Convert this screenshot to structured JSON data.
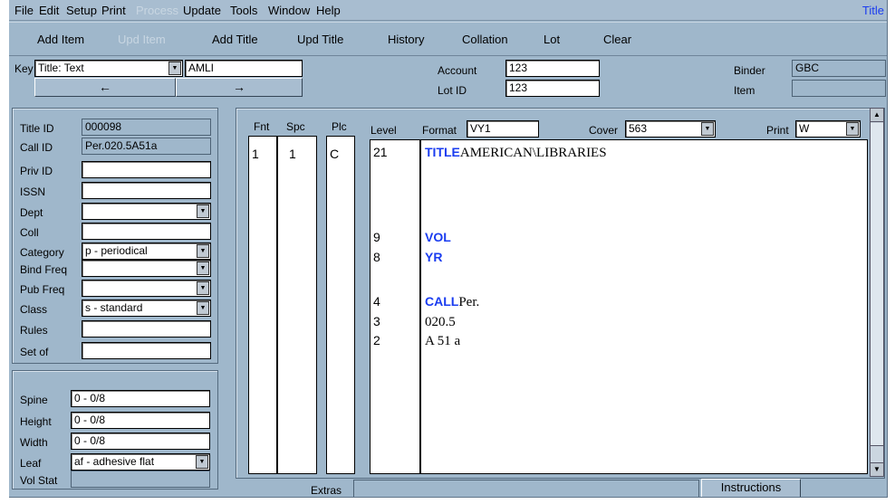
{
  "menu": {
    "file": "File",
    "edit": "Edit",
    "setup": "Setup",
    "print": "Print",
    "process": "Process",
    "update": "Update",
    "tools": "Tools",
    "window": "Window",
    "help": "Help",
    "title": "Title"
  },
  "toolbar": {
    "add_item": "Add Item",
    "upd_item": "Upd Item",
    "add_title": "Add Title",
    "upd_title": "Upd Title",
    "history": "History",
    "collation": "Collation",
    "lot": "Lot",
    "clear": "Clear"
  },
  "key": {
    "label": "Key",
    "select": "Title: Text",
    "value": "AMLI",
    "prev": "←",
    "next": "→"
  },
  "account": {
    "label": "Account",
    "value": "123"
  },
  "lot_id": {
    "label": "Lot ID",
    "value": "123"
  },
  "binder": {
    "label": "Binder",
    "value": "GBC"
  },
  "item": {
    "label": "Item",
    "value": ""
  },
  "title_fields": {
    "title_id": {
      "label": "Title ID",
      "value": "000098"
    },
    "call_id": {
      "label": "Call ID",
      "value": "Per.020.5A51a"
    },
    "priv_id": {
      "label": "Priv ID",
      "value": ""
    },
    "issn": {
      "label": "ISSN",
      "value": ""
    },
    "dept": {
      "label": "Dept",
      "value": ""
    },
    "coll": {
      "label": "Coll",
      "value": ""
    },
    "category": {
      "label": "Category",
      "value": "p - periodical"
    },
    "bind_freq": {
      "label": "Bind Freq",
      "value": ""
    },
    "pub_freq": {
      "label": "Pub Freq",
      "value": ""
    },
    "class": {
      "label": "Class",
      "value": "s - standard"
    },
    "rules": {
      "label": "Rules",
      "value": ""
    },
    "set_of": {
      "label": "Set of",
      "value": ""
    }
  },
  "dims": {
    "spine": {
      "label": "Spine",
      "value": "0 - 0/8"
    },
    "height": {
      "label": "Height",
      "value": "0 - 0/8"
    },
    "width": {
      "label": "Width",
      "value": "0 - 0/8"
    },
    "leaf": {
      "label": "Leaf",
      "value": "af - adhesive flat"
    },
    "vol_stat": {
      "label": "Vol Stat",
      "value": ""
    }
  },
  "layout_editor": {
    "fnt_header": "Fnt",
    "spc_header": "Spc",
    "plc_header": "Plc",
    "level_header": "Level",
    "fnt_value": "1",
    "spc_value": "1",
    "plc_value": "C",
    "format": {
      "label": "Format",
      "value": "VY1"
    },
    "cover": {
      "label": "Cover",
      "value": "563"
    },
    "print": {
      "label": "Print",
      "value": "W"
    },
    "lines": [
      {
        "level": "21",
        "keyword": "TITLE",
        "text": "AMERICAN\\LIBRARIES"
      },
      {
        "level": "9",
        "keyword": "VOL",
        "text": ""
      },
      {
        "level": "8",
        "keyword": "YR",
        "text": ""
      },
      {
        "level": "4",
        "keyword": "CALL",
        "text": "Per."
      },
      {
        "level": "3",
        "keyword": "",
        "text": "020.5"
      },
      {
        "level": "2",
        "keyword": "",
        "text": "A 51 a"
      }
    ]
  },
  "extras": {
    "label": "Extras",
    "value": ""
  },
  "instructions_label": "Instructions",
  "icons": {
    "dropdown": "chevron-down-icon",
    "scroll_up": "arrow-up-icon",
    "scroll_down": "arrow-down-icon"
  }
}
